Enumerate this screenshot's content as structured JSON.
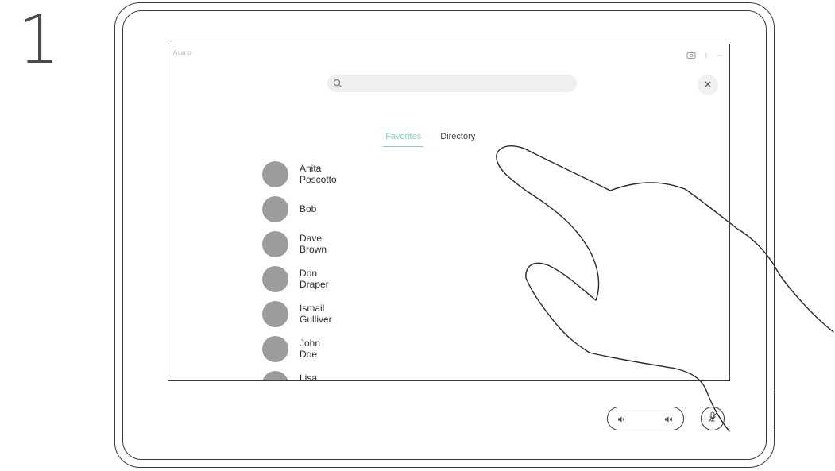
{
  "step_number": "1",
  "topbar": {
    "title": "Acano",
    "icons": [
      "camera-icon",
      "signal-icon",
      "more-icon"
    ]
  },
  "search": {
    "placeholder": "",
    "icon": "search-icon"
  },
  "close_icon": "close-icon",
  "tabs": [
    {
      "label": "Favorites",
      "active": true
    },
    {
      "label": "Directory",
      "active": false
    }
  ],
  "contacts": [
    {
      "name": "Anita Poscotto"
    },
    {
      "name": "Bob"
    },
    {
      "name": "Dave Brown"
    },
    {
      "name": "Don Draper"
    },
    {
      "name": "Ismail Gulliver"
    },
    {
      "name": "John Doe"
    },
    {
      "name": "Lisa Green"
    }
  ],
  "controls": {
    "volume_down_icon": "volume-down-icon",
    "volume_up_icon": "volume-up-icon",
    "mute_icon": "microphone-mute-icon"
  },
  "colors": {
    "accent": "#86d3b2",
    "outline": "#3a3a3a",
    "avatar": "#9c9c9c"
  }
}
